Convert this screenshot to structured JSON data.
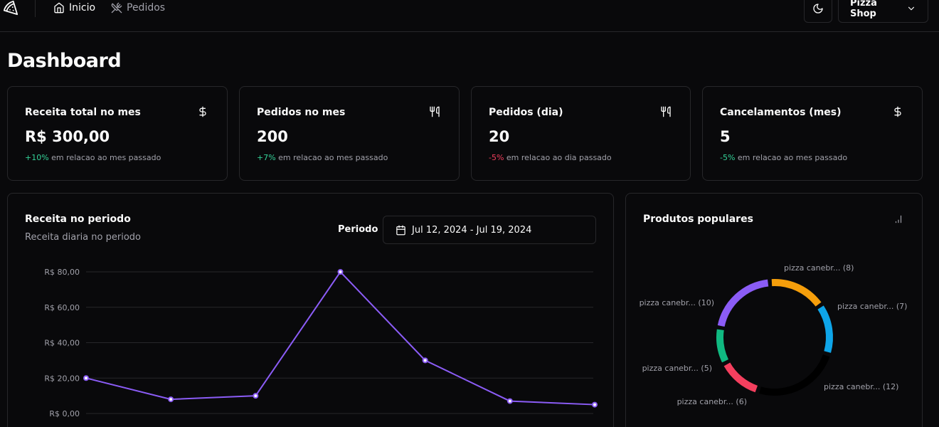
{
  "header": {
    "nav": [
      {
        "label": "Inicio",
        "icon": "home-icon"
      },
      {
        "label": "Pedidos",
        "icon": "utensils-crossed-icon"
      }
    ],
    "store_label": "Pizza Shop"
  },
  "page_title": "Dashboard",
  "stats": [
    {
      "title": "Receita total no mes",
      "icon": "dollar-icon",
      "value": "R$ 300,00",
      "change": "+10%",
      "change_text": " em relacao ao mes passado",
      "change_color": "#34d399"
    },
    {
      "title": "Pedidos no mes",
      "icon": "utensils-icon",
      "value": "200",
      "change": "+7%",
      "change_text": " em relacao ao mes passado",
      "change_color": "#34d399"
    },
    {
      "title": "Pedidos (dia)",
      "icon": "utensils-icon",
      "value": "20",
      "change": "-5%",
      "change_text": " em relacao ao dia passado",
      "change_color": "#f43f5e"
    },
    {
      "title": "Cancelamentos (mes)",
      "icon": "dollar-icon",
      "value": "5",
      "change": "-5%",
      "change_text": " em relacao ao mes passado",
      "change_color": "#34d399"
    }
  ],
  "revenue": {
    "title": "Receita no periodo",
    "description": "Receita diaria no periodo",
    "period_label": "Periodo",
    "date_range": "Jul 12, 2024 - Jul 19, 2024"
  },
  "popular": {
    "title": "Produtos populares"
  },
  "chart_data": [
    {
      "type": "line",
      "title": "Receita no periodo",
      "y_ticks": [
        "R$ 0,00",
        "R$ 20,00",
        "R$ 40,00",
        "R$ 60,00",
        "R$ 80,00"
      ],
      "ylim": [
        0,
        80
      ],
      "values": [
        20,
        8,
        10,
        80,
        30,
        7,
        5
      ],
      "grid": true,
      "line_color": "#8b5cf6"
    },
    {
      "type": "pie",
      "title": "Produtos populares",
      "slices": [
        {
          "label": "pizza canebr... (8)",
          "value": 8,
          "color": "#f59e0b"
        },
        {
          "label": "pizza canebr... (7)",
          "value": 7,
          "color": "#0ea5e9"
        },
        {
          "label": "pizza canebr... (12)",
          "value": 12,
          "color": "#000000"
        },
        {
          "label": "pizza canebr... (6)",
          "value": 6,
          "color": "#f43f5e"
        },
        {
          "label": "pizza canebr... (5)",
          "value": 5,
          "color": "#10b981"
        },
        {
          "label": "pizza canebr... (10)",
          "value": 10,
          "color": "#8b5cf6"
        }
      ]
    }
  ]
}
